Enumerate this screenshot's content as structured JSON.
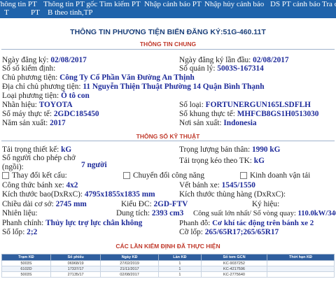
{
  "nav": {
    "row1": [
      "Thông tin PT",
      "Thông tin PT gốc",
      "Tìm kiếm PT",
      "Nhập cảnh báo PT",
      "Nhập hủy cảnh báo",
      "DS PT cảnh báo",
      "Tra c"
    ],
    "row2": [
      "T",
      "PT",
      "B theo tỉnh,TP"
    ]
  },
  "title": "THÔNG TIN PHƯƠNG TIỆN BIỂN ĐĂNG KÝ:51G-460.11T",
  "sections": {
    "general": "THÔNG TIN CHUNG",
    "technical": "THÔNG SỐ KỸ THUẬT",
    "inspections": "CÁC LẦN KIỂM ĐỊNH ĐÃ THỰC HIỆN"
  },
  "fields": {
    "reg_date_label": "Ngày đăng ký:",
    "reg_date": "02/08/2017",
    "first_reg_label": "Ngày đăng ký lần đầu:",
    "first_reg": "02/08/2017",
    "inspect_no_label": "Số sổ kiểm định:",
    "mgmt_no_label": "Số quản lý:",
    "mgmt_no": "5003S-167314",
    "owner_label": "Chủ phương tiện:",
    "owner": "Công Ty Cổ Phần Văn Đường An Thịnh",
    "address_label": "Địa chỉ chủ phương tiện:",
    "address": "11 Nguyễn Thiện Thuật Phường 14 Quận Bình Thạnh",
    "type_label": "Loại phương tiện:",
    "type": "Ô tô con",
    "brand_label": "Nhãn hiệu:",
    "brand": "TOYOTA",
    "model_label": "Số loại:",
    "model": "FORTUNERGUN165LSDFLH",
    "engine_label": "Số máy thực tế:",
    "engine": "2GDC185450",
    "chassis_label": "Số khung thực tế:",
    "chassis": "MHFCB8GS1H0513030",
    "year_label": "Năm sản xuất:",
    "year": "2017",
    "origin_label": "Nơi sản xuất:",
    "origin": "Indonesia",
    "design_load_label": "Tải trọng thiết kế:",
    "design_load": "kG",
    "curb_weight_label": "Trọng lượng bản thân:",
    "curb_weight": "1990 kG",
    "seats_label": "Số người cho phép chở (ngồi):",
    "seats": "7 người",
    "towing_label": "Tải trọng kéo theo TK:",
    "towing": "kG",
    "cb1": "Thay đổi kết cấu:",
    "cb2": "Chuyển đổi công năng",
    "cb3": "Kinh doanh vận tải",
    "wheel_formula_label": "Công thức bánh xe:",
    "wheel_formula": "4x2",
    "track_label": "Vết bánh xe:",
    "track": "1545/1550",
    "dims_label": "Kích thước bao(DxRxC):",
    "dims": "4795x1855x1835 mm",
    "cargo_dims_label": "Kích thước thùng hàng (DxRxC):",
    "wheelbase_label": "Chiều dài cơ sở:",
    "wheelbase": "2745 mm",
    "engine_type_label": "Kiểu ĐC:",
    "engine_type": "2GD-FTV",
    "symbol_label": "Ký hiệu:",
    "fuel_label": "Nhiên liệu:",
    "displacement_label": "Dung tích:",
    "displacement": "2393 cm3",
    "power_label": "Công suất lớn nhất/ Số vòng quay:",
    "power": "110.0kW/3400",
    "brake_label": "Phanh chính:",
    "brake": "Thủy lực trợ lực chân không",
    "handbrake_label": "Phanh đỗ:",
    "handbrake": "Cơ khí tác động trên bánh xe 2",
    "tyre_count_label": "Số lốp:",
    "tyre_count": "2;2",
    "tyre_size_label": "Cỡ lốp:",
    "tyre_size": "265/65R17;265/65R17"
  },
  "table": {
    "headers": [
      "Trạm KĐ",
      "Số phiếu",
      "Ngày KĐ",
      "Lần KĐ",
      "Số tem GCN",
      "Thời hạn KĐ"
    ],
    "rows": [
      [
        "5003S",
        "06968/19",
        "27/02/2019",
        "1",
        "KC-9037252",
        ""
      ],
      [
        "6102D",
        "17337/17",
        "21/11/2017",
        "1",
        "KC-4217596",
        ""
      ],
      [
        "5003S",
        "27135/17",
        "02/08/2017",
        "1",
        "KC-2775640",
        ""
      ]
    ]
  }
}
